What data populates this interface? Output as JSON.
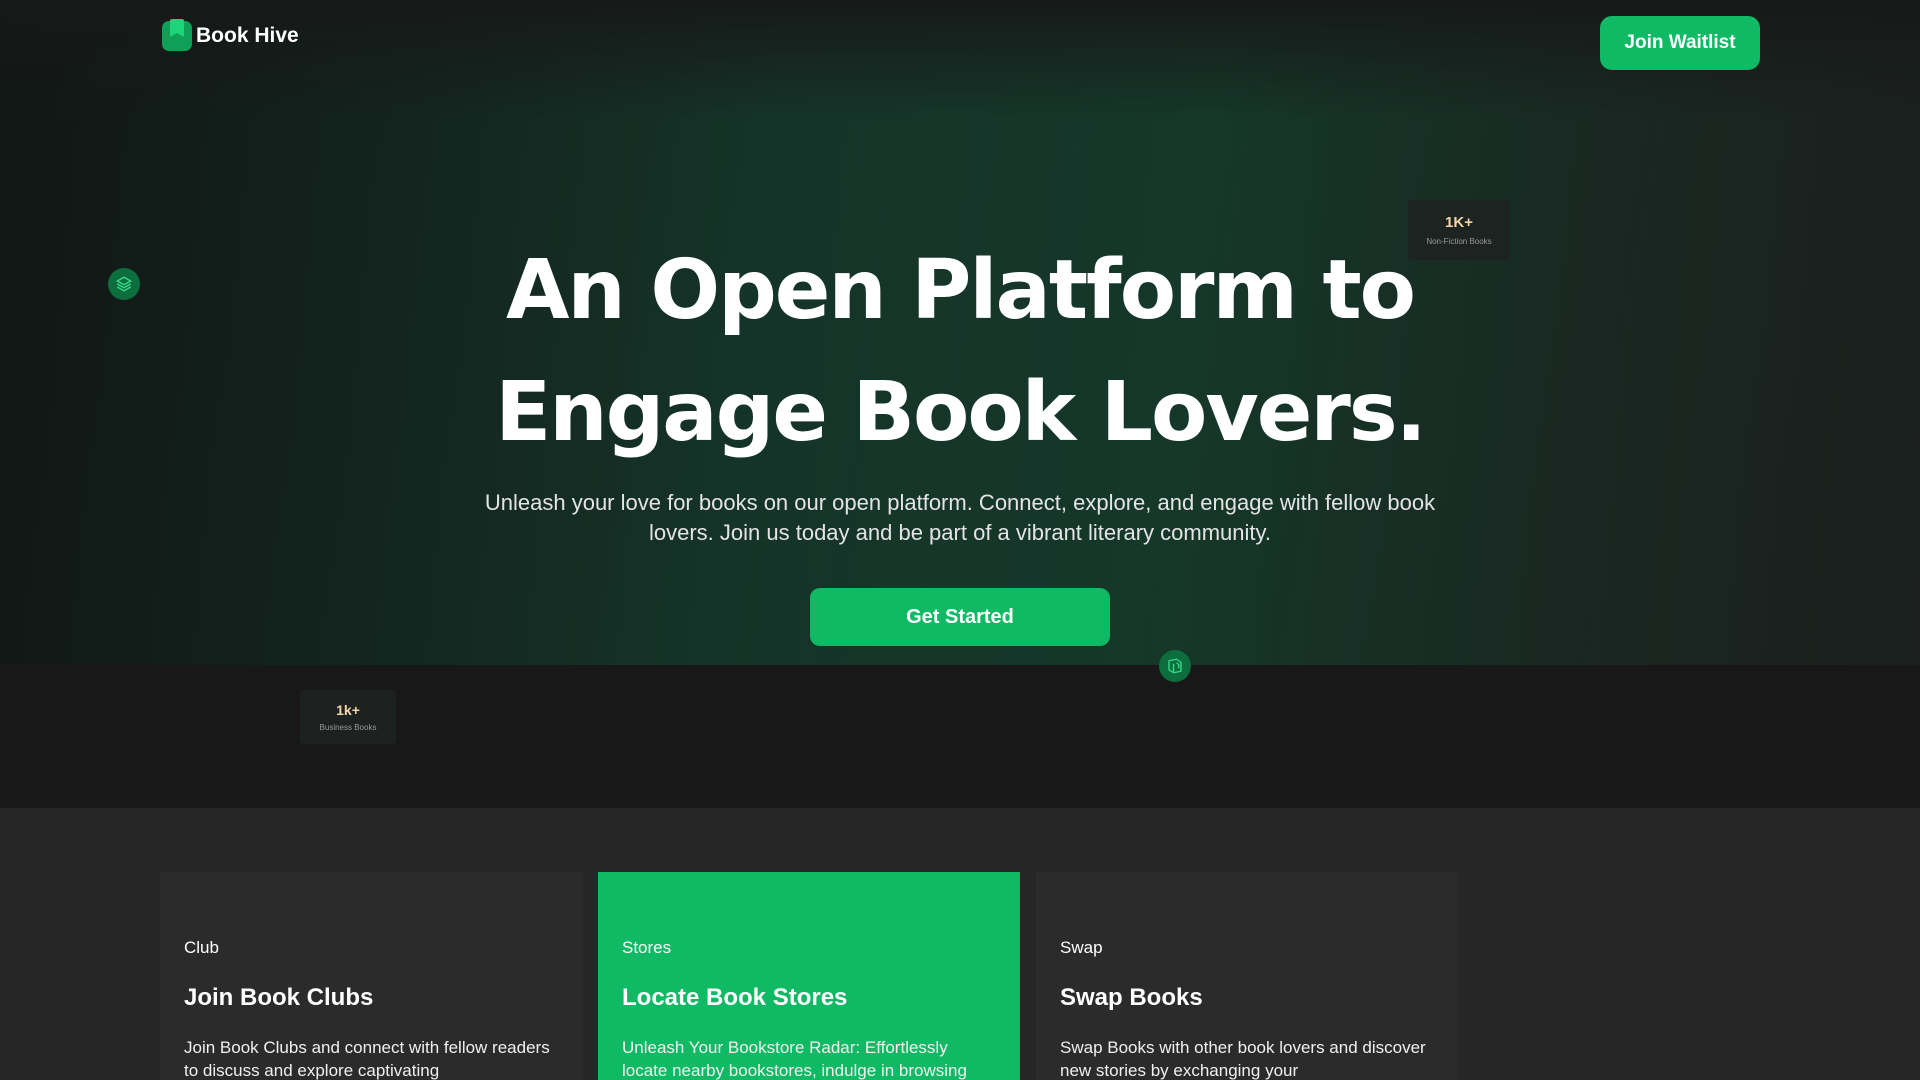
{
  "header": {
    "brand": "Book Hive",
    "waitlist_label": "Join Waitlist"
  },
  "hero": {
    "headline_line1": "An Open Platform to",
    "headline_line2": "Engage Book Lovers.",
    "subtext": "Unleash your love for books on our open platform. Connect, explore, and engage with fellow book lovers. Join us today and be part of a vibrant literary community.",
    "cta_label": "Get Started"
  },
  "stats": [
    {
      "value": "1K+",
      "label": "Non-Fiction Books"
    },
    {
      "value": "1k+",
      "label": "Business Books"
    }
  ],
  "icons": {
    "left_float": "layers-icon",
    "center_float": "book-open-icon"
  },
  "features": [
    {
      "tag": "Club",
      "title": "Join Book Clubs",
      "description": "Join Book Clubs and connect with fellow readers to discuss and explore captivating"
    },
    {
      "tag": "Stores",
      "title": "Locate Book Stores",
      "description": "Unleash Your Bookstore Radar: Effortlessly locate nearby bookstores, indulge in browsing"
    },
    {
      "tag": "Swap",
      "title": "Swap Books",
      "description": "Swap Books with other book lovers and discover new stories by exchanging your"
    }
  ],
  "colors": {
    "accent": "#10b963",
    "background": "#181818",
    "stat_value": "#f6d6a8"
  }
}
